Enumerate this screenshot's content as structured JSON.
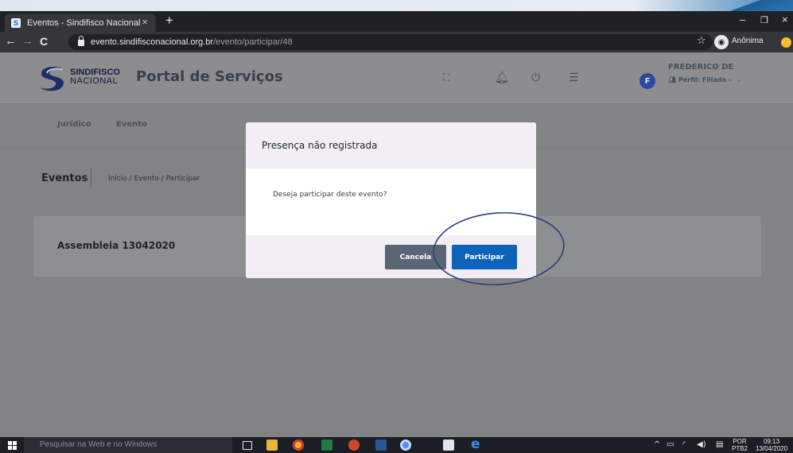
{
  "browser": {
    "tab_title": "Eventos - Sindifisco Nacional",
    "tab_favicon": "S",
    "tab_close": "×",
    "new_tab": "+",
    "url_host": "evento.sindifisconacional.org.br",
    "url_path": "/evento/participar/48",
    "incognito_label": "Anônima",
    "window_minimize": "–",
    "window_restore": "❐",
    "window_close": "×"
  },
  "header": {
    "logo_line1": "SINDIFISCO",
    "logo_line2": "NACIONAL",
    "portal_title": "Portal de Serviços",
    "user_initial": "F",
    "user_name": "FREDERICO DE",
    "user_profile": "Perfil: Filiado -"
  },
  "nav": {
    "items": [
      {
        "label": "Jurídico"
      },
      {
        "label": "Evento"
      }
    ]
  },
  "page": {
    "section_title": "Eventos",
    "breadcrumb": "Início / Evento / Participar",
    "event_title": "Assembleia 13042020"
  },
  "modal": {
    "title": "Presença não registrada",
    "message": "Deseja participar deste evento?",
    "cancel_label": "Cancela",
    "confirm_label": "Participar"
  },
  "taskbar": {
    "search_placeholder": "Pesquisar na Web e no Windows",
    "lang_line1": "POR",
    "lang_line2": "PTB2",
    "time": "09:13",
    "date": "13/04/2020"
  },
  "colors": {
    "primary_button": "#0d62b9",
    "cancel_button": "#5b6675",
    "annotation_circle": "#2a3f7e"
  }
}
